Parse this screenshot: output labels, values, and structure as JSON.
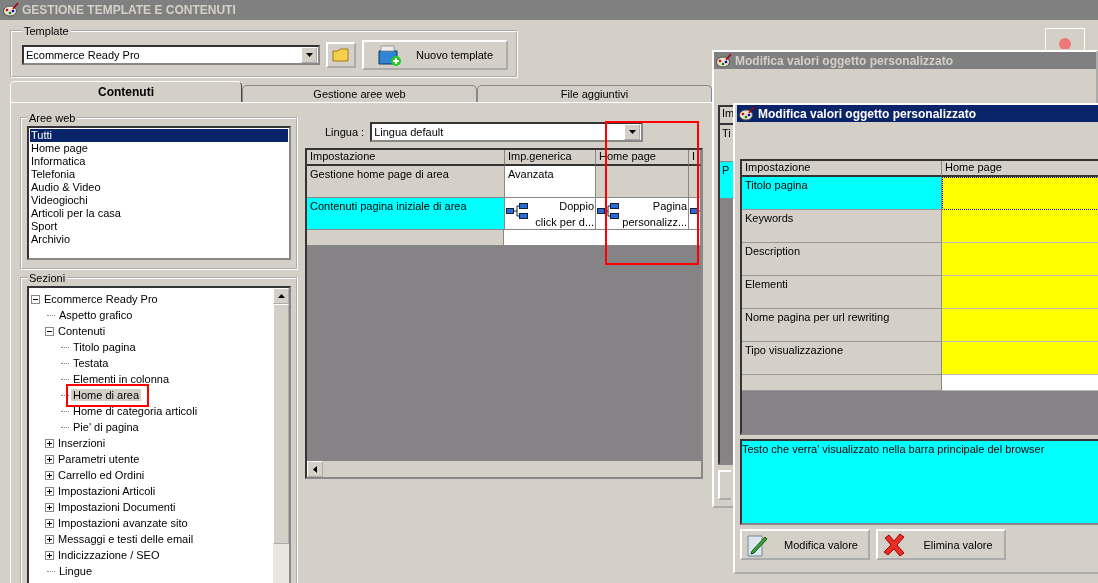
{
  "window": {
    "title": "GESTIONE TEMPLATE E CONTENUTI"
  },
  "template": {
    "label": "Template",
    "value": "Ecommerce Ready Pro",
    "new_button": "Nuovo template"
  },
  "tabs": [
    {
      "label": "Contenuti",
      "selected": true
    },
    {
      "label": "Gestione aree web",
      "selected": false
    },
    {
      "label": "File aggiuntivi",
      "selected": false
    }
  ],
  "aree_web": {
    "label": "Aree web",
    "items": [
      {
        "label": "Tutti",
        "selected": true
      },
      {
        "label": "Home page",
        "selected": false
      },
      {
        "label": "Informatica",
        "selected": false
      },
      {
        "label": "Telefonia",
        "selected": false
      },
      {
        "label": "Audio & Video",
        "selected": false
      },
      {
        "label": "Videogiochi",
        "selected": false
      },
      {
        "label": "Articoli per la casa",
        "selected": false
      },
      {
        "label": "Sport",
        "selected": false
      },
      {
        "label": "Archivio",
        "selected": false
      }
    ]
  },
  "sezioni": {
    "label": "Sezioni",
    "tree": [
      {
        "label": "Ecommerce Ready Pro",
        "selected": false,
        "expanded": true,
        "children": [
          {
            "label": "Aspetto grafico",
            "selected": false
          },
          {
            "label": "Contenuti",
            "selected": false,
            "expanded": true,
            "children": [
              {
                "label": "Titolo pagina",
                "selected": false
              },
              {
                "label": "Testata",
                "selected": false
              },
              {
                "label": "Elementi in colonna",
                "selected": false
              },
              {
                "label": "Home di area",
                "selected": true
              },
              {
                "label": "Home di categoria articoli",
                "selected": false
              },
              {
                "label": "Pie' di pagina",
                "selected": false
              }
            ]
          },
          {
            "label": "Inserzioni",
            "selected": false,
            "expanded": false
          },
          {
            "label": "Parametri utente",
            "selected": false,
            "expanded": false
          },
          {
            "label": "Carrello ed Ordini",
            "selected": false,
            "expanded": false
          },
          {
            "label": "Impostazioni Articoli",
            "selected": false,
            "expanded": false
          },
          {
            "label": "Impostazioni Documenti",
            "selected": false,
            "expanded": false
          },
          {
            "label": "Impostazioni avanzate sito",
            "selected": false,
            "expanded": false
          },
          {
            "label": "Messaggi e testi delle email",
            "selected": false,
            "expanded": false
          },
          {
            "label": "Indicizzazione / SEO",
            "selected": false,
            "expanded": false
          },
          {
            "label": "Lingue",
            "selected": false
          }
        ]
      }
    ]
  },
  "lingua": {
    "label": "Lingua :",
    "value": "Lingua default"
  },
  "grid": {
    "columns": [
      "Impostazione",
      "Imp.generica",
      "Home page",
      "I"
    ],
    "rows": [
      {
        "selected": false,
        "cells": [
          {
            "kind": "label",
            "text": "Gestione home page di area"
          },
          {
            "kind": "text",
            "text": "Avanzata"
          },
          {
            "kind": "none"
          },
          {
            "kind": "none"
          }
        ]
      },
      {
        "selected": true,
        "cells": [
          {
            "kind": "label",
            "text": "Contenuti pagina iniziale di area"
          },
          {
            "kind": "object",
            "text": "Doppio\nclick per d..."
          },
          {
            "kind": "object",
            "text": "Pagina\npersonalizz..."
          },
          {
            "kind": "object"
          }
        ]
      }
    ]
  },
  "back_dialog": {
    "title": "Modifica valori oggetto personalizzato",
    "header": "Im",
    "rows": [
      {
        "text": "Ti",
        "selected": false
      },
      {
        "text": "P",
        "selected": true
      }
    ]
  },
  "dialog": {
    "title": "Modifica valori oggetto personalizzato",
    "columns": [
      "Impostazione",
      "Home page"
    ],
    "rows": [
      {
        "label": "Titolo pagina",
        "selected": true
      },
      {
        "label": "Keywords",
        "selected": false
      },
      {
        "label": "Description",
        "selected": false
      },
      {
        "label": "Elementi",
        "selected": false
      },
      {
        "label": "Nome pagina per url rewriting",
        "selected": false
      },
      {
        "label": "Tipo visualizzazione",
        "selected": false
      }
    ],
    "description": "Testo che verra' visualizzato nella barra principale del browser",
    "buttons": [
      {
        "label": "Modifica valore",
        "kind": "edit"
      },
      {
        "label": "Elimina valore",
        "kind": "delete"
      }
    ]
  }
}
